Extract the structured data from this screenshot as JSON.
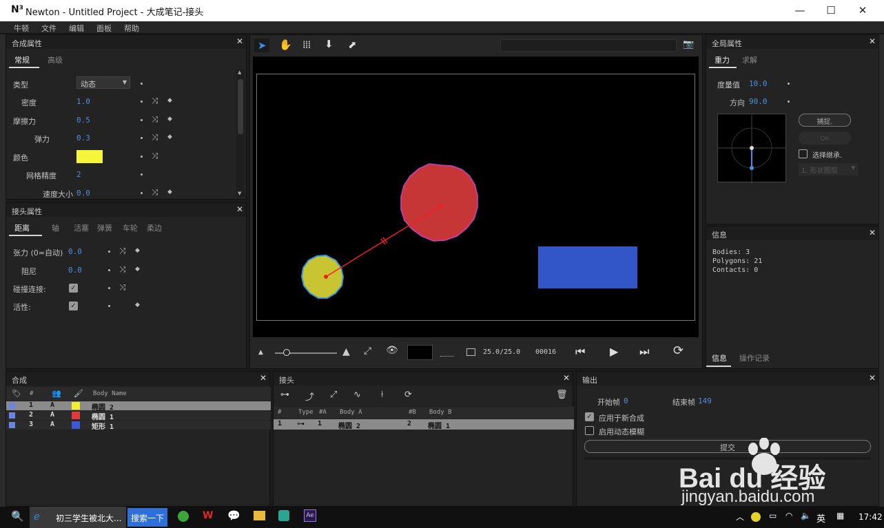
{
  "window": {
    "logo": "N³",
    "title": "Newton - Untitled Project - 大成笔记-接头",
    "minimize": "—",
    "maximize": "☐",
    "close": "✕"
  },
  "menu": [
    "牛顿",
    "文件",
    "编辑",
    "面板",
    "帮助"
  ],
  "composite_props": {
    "title": "合成属性",
    "tabs": [
      "常规",
      "高级"
    ],
    "type_label": "类型",
    "type_value": "动态",
    "density_label": "密度",
    "density_value": "1.0",
    "friction_label": "摩擦力",
    "friction_value": "0.5",
    "bounce_label": "弹力",
    "bounce_value": "0.3",
    "color_label": "颜色",
    "color_value": "#f5f53a",
    "mesh_label": "网格精度",
    "mesh_value": "2",
    "velocity_label": "速度大小",
    "velocity_value": "0.0"
  },
  "joint_props": {
    "title": "接头属性",
    "tabs": [
      "距离",
      "轴",
      "活塞",
      "弹簧",
      "车轮",
      "柔边"
    ],
    "tension_label": "张力 (0=自动)",
    "tension_value": "0.0",
    "damping_label": "阻尼",
    "damping_value": "0.0",
    "collide_label": "碰撞连接:",
    "active_label": "活性:"
  },
  "viewport": {
    "tools": [
      "select-tool",
      "hand-tool",
      "grid-tool",
      "gravity-tool",
      "export-tool"
    ],
    "fps": "25.0/25.0",
    "frame": "00016"
  },
  "global_props": {
    "title": "全局属性",
    "tabs": [
      "重力",
      "求解"
    ],
    "magnitude_label": "度量值",
    "magnitude_value": "10.0",
    "direction_label": "方向",
    "direction_value": "90.0",
    "capture_btn": "捕捉.",
    "ok_btn": "OK",
    "select_inherit": "选择继承.",
    "shape_select": "1. 形状图层"
  },
  "info": {
    "title": "信息",
    "bodies": "Bodies: 3",
    "polygons": "Polygons: 21",
    "contacts": "Contacts: 0",
    "tabs": [
      "信息",
      "操作记录"
    ]
  },
  "composite": {
    "title": "合成",
    "headers": [
      "#",
      "Body Name"
    ],
    "rows": [
      {
        "num": "1",
        "a": "A",
        "color": "#f2ef33",
        "name": "椭圆 2",
        "selected": true
      },
      {
        "num": "2",
        "a": "A",
        "color": "#e03a3a",
        "name": "椭圆 1",
        "selected": false
      },
      {
        "num": "3",
        "a": "A",
        "color": "#3c5ad6",
        "name": "矩形 1",
        "selected": false
      }
    ]
  },
  "joints": {
    "title": "接头",
    "headers": [
      "#",
      "Type",
      "#A",
      "Body A",
      "#B",
      "Body B"
    ],
    "rows": [
      {
        "num": "1",
        "type": "⊶",
        "a": "1",
        "body_a": "椭圆 2",
        "b": "2",
        "body_b": "椭圆 1"
      }
    ]
  },
  "output": {
    "title": "输出",
    "start_label": "开始帧",
    "start_value": "0",
    "end_label": "结束帧",
    "end_value": "149",
    "apply_new": "应用于新合成",
    "motion_blur": "启用动态模糊",
    "submit": "提交"
  },
  "watermark": {
    "brand": "Bai du 经验",
    "url": "jingyan.baidu.com"
  },
  "taskbar": {
    "browser_title": "初三学生被北大...",
    "search_btn": "搜索一下",
    "ime": "英",
    "time": "17:42"
  },
  "colors": {
    "accent": "#4d8fe0",
    "red_body": "#c73636",
    "yellow_body": "#c8c432",
    "blue_body": "#3256c8"
  }
}
